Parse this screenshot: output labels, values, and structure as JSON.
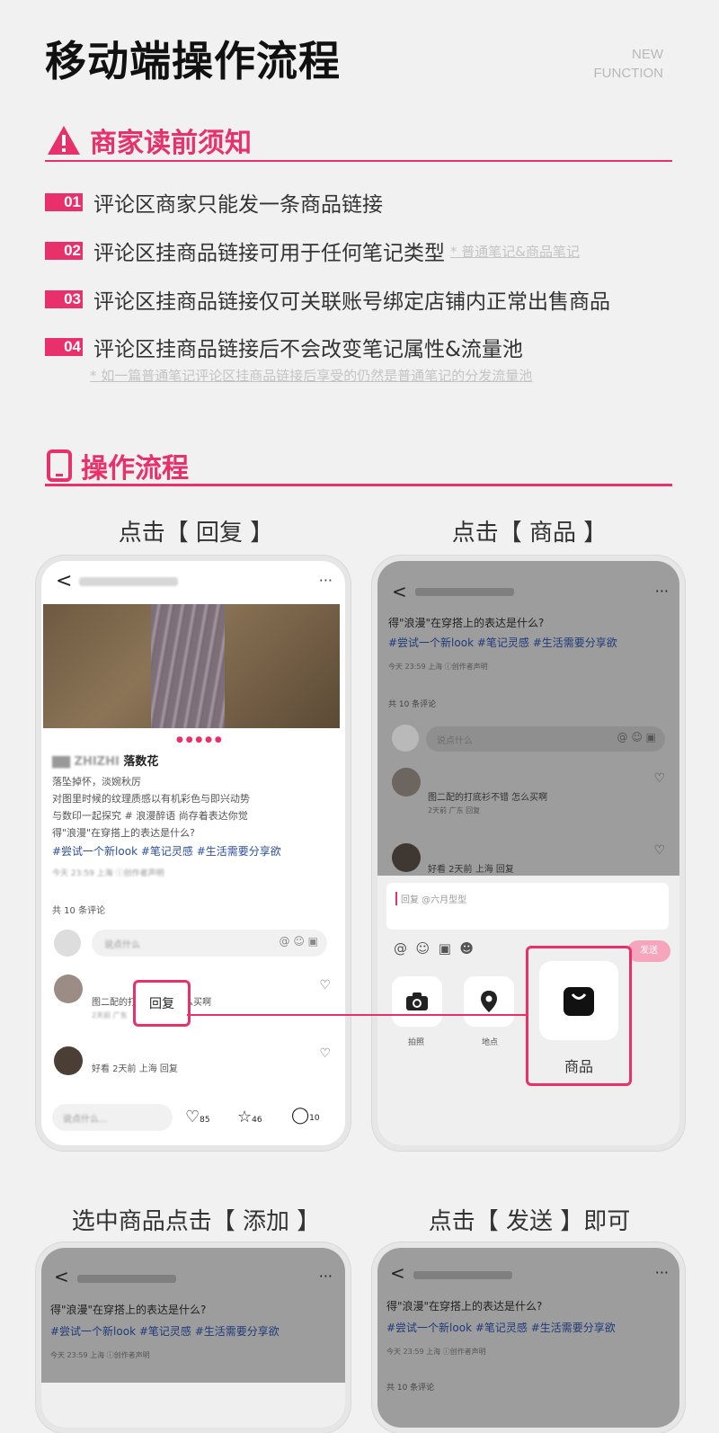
{
  "header": {
    "title": "移动端操作流程",
    "new_function": [
      "NEW",
      "FUNCTION"
    ]
  },
  "notice": {
    "heading": "商家读前须知",
    "items": [
      {
        "num": "01",
        "text": "评论区商家只能发一条商品链接",
        "note": ""
      },
      {
        "num": "02",
        "text": "评论区挂商品链接可用于任何笔记类型",
        "note": "* 普通笔记&商品笔记"
      },
      {
        "num": "03",
        "text": "评论区挂商品链接仅可关联账号绑定店铺内正常出售商品",
        "note": ""
      },
      {
        "num": "04",
        "text": "评论区挂商品链接后不会改变笔记属性&流量池",
        "note": ""
      }
    ],
    "footnote": "* 如一篇普通笔记评论区挂商品链接后享受的仍然是普通笔记的分发流量池"
  },
  "flow": {
    "heading": "操作流程",
    "steps": [
      {
        "caption": "点击【 回复 】"
      },
      {
        "caption": "点击【 商品 】"
      },
      {
        "caption": "选中商品点击【 添加 】"
      },
      {
        "caption": "点击【 发送 】即可"
      }
    ]
  },
  "phone1": {
    "back": "<",
    "more": "···",
    "author": "落数花",
    "body": [
      "落坠掉怀，淡婉秋厉",
      "对图里时候的纹理质感以有机彩色与即兴动势",
      "与数印一起探究 # 浪漫醉语 尚存着表达你觉",
      "得\"浪漫\"在穿搭上的表达是什么?"
    ],
    "tags": "#尝试一个新look #笔记灵感 #生活需要分享欲",
    "meta": "今天 23:59 上海 ⓘ创作者声明",
    "count": "共 10 条评论",
    "input_ph": "说点什么",
    "reply_label": "回复",
    "comment1": "图二配的打底衫不错 怎么买啊",
    "comment1_meta": "2天前 广东",
    "comment2": "好看 2天前 上海 回复",
    "bottom_ph": "说点什么...",
    "likes": "85",
    "stars": "46",
    "comments": "10"
  },
  "phone2": {
    "back": "<",
    "more": "···",
    "q": "得\"浪漫\"在穿搭上的表达是什么?",
    "tags": "#尝试一个新look #笔记灵感 #生活需要分享欲",
    "meta": "今天 23:59 上海 ⓘ创作者声明",
    "count": "共 10 条评论",
    "input_ph": "说点什么",
    "comment1": "图二配的打底衫不错 怎么买啊",
    "comment1_meta": "2天前 广东 回复",
    "comment2": "好看 2天前 上海 回复",
    "reply_to": "回复 @六月型型",
    "send": "发送",
    "tool1": "拍照",
    "tool2": "地点",
    "product": "商品"
  },
  "phone3": {
    "back": "<",
    "more": "···",
    "q": "得\"浪漫\"在穿搭上的表达是什么?",
    "tags": "#尝试一个新look #笔记灵感 #生活需要分享欲",
    "meta": "今天 23:59 上海 ⓘ创作者声明"
  },
  "phone4": {
    "back": "<",
    "more": "···",
    "q": "得\"浪漫\"在穿搭上的表达是什么?",
    "tags": "#尝试一个新look #笔记灵感 #生活需要分享欲",
    "meta": "今天 23:59 上海 ⓘ创作者声明",
    "count": "共 10 条评论"
  },
  "colors": {
    "accent": "#e8306a",
    "tag": "#2d4f9e",
    "bg": "#f1f1f1"
  }
}
